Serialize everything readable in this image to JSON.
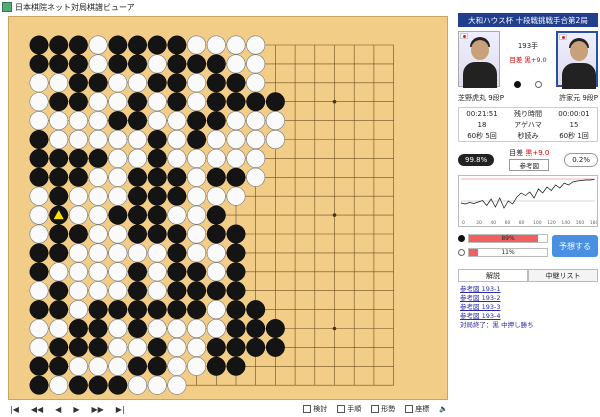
{
  "window": {
    "title": "日本棋院ネット対局棋譜ビューア"
  },
  "event": "大和ハウス杯 十段戦挑戦手合第2局",
  "players": {
    "black": {
      "name": "芝野虎丸",
      "rank": "9段P"
    },
    "white": {
      "name": "許家元",
      "rank": "9段P"
    }
  },
  "game": {
    "move_label": "193手",
    "result_label": "目差",
    "result_value": "黒+9.0"
  },
  "info_rows": [
    [
      "00:21:51",
      "残り時間",
      "00:00:01"
    ],
    [
      "18",
      "アゲハマ",
      "15"
    ],
    [
      "60秒 5回",
      "秒読み",
      "60秒 1回"
    ]
  ],
  "score": {
    "black_pct": "99.8%",
    "white_pct": "0.2%",
    "diff_label": "目差",
    "diff_value": "黒+9.0",
    "ref_button": "参考図"
  },
  "graph": {
    "x_ticks": [
      "0",
      "20",
      "40",
      "60",
      "80",
      "100",
      "120",
      "140",
      "160",
      "180"
    ]
  },
  "bars": {
    "black": {
      "value": 89,
      "label": "89%"
    },
    "white": {
      "value": 11,
      "label": "11%"
    }
  },
  "predict_button": "予想する",
  "tabs": [
    "解説",
    "中継リスト"
  ],
  "links": [
    "参考図 193-1",
    "参考図 193-2",
    "参考図 193-3",
    "参考図 193-4"
  ],
  "end_text": "対局終了：黒 中押し勝ち",
  "toolbar": {
    "tools": [
      "検討",
      "手順",
      "形勢",
      "座標"
    ]
  },
  "colors": {
    "event_bar": "#213f8d",
    "board": "#f2cd87",
    "predict": "#4a90e2"
  },
  "board": {
    "size": 19,
    "stones": [
      "BBBWBBBBWWWW.......",
      "BBBWBBWBBBWW.......",
      "WWBBWWBBWBBW.......",
      "WBBWWBWBWBBBB......",
      "WWWWBBWWBBWWW......",
      "BWWWWWBWBWWWW......",
      "BBBBWWBWWWWW.......",
      "BBBWWBBBWBBW.......",
      "WBWWWBBBWWW........",
      "WBWWBBBWWB.........",
      "WBBWWBBBWBB........",
      "BBWWWWWBWWB........",
      "BWWWWBWBBWB........",
      "WBWWWBWBBBB........",
      "BBWBBBBBBWBB.......",
      "WWBBWBWWWWBBB......",
      "WBBBWWBWWBBBB......",
      "BBWWWBBWWBB........",
      "BWBBBWWW..........."
    ],
    "last_move_marker": "triangle"
  }
}
